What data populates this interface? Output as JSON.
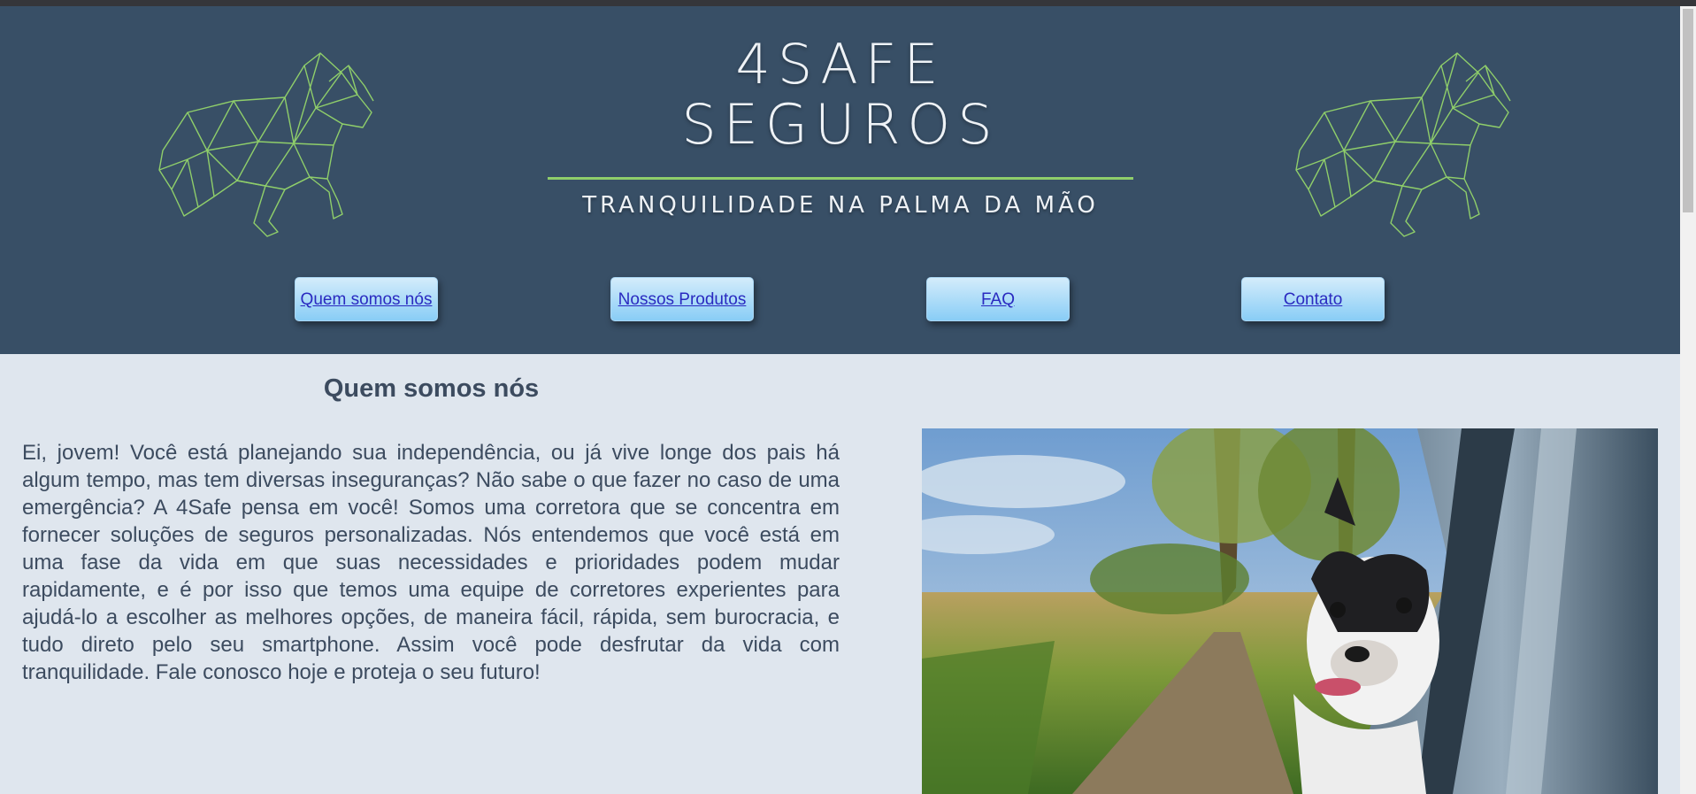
{
  "header": {
    "brand_line1": "4SAFE",
    "brand_line2": "SEGUROS",
    "tagline": "TRANQUILIDADE NA PALMA DA MÃO",
    "accent_color": "#8fce6a",
    "background_color": "#384f66",
    "logo_icon": "geometric-horse-icon"
  },
  "nav": {
    "items": [
      {
        "label": "Quem somos nós"
      },
      {
        "label": "Nossos Produtos"
      },
      {
        "label": "FAQ"
      },
      {
        "label": "Contato"
      }
    ]
  },
  "main": {
    "section_title": "Quem somos nós",
    "paragraph": "Ei, jovem! Você está planejando sua independência, ou já vive longe dos pais há algum tempo, mas tem diversas inseguranças? Não sabe o que fazer no caso de uma emergência? A 4Safe pensa em você! Somos uma corretora que se concentra em fornecer soluções de seguros personalizadas. Nós entendemos que você está em uma fase da vida em que suas necessidades e prioridades podem mudar rapidamente, e é por isso que temos uma equipe de corretores experientes para ajudá-lo a escolher as melhores opções, de maneira fácil, rápida, sem burocracia, e tudo direto pelo seu smartphone. Assim você pode desfrutar da vida com tranquilidade. Fale conosco hoje e proteja o seu futuro!",
    "photo_icon": "dog-in-car-photo"
  }
}
